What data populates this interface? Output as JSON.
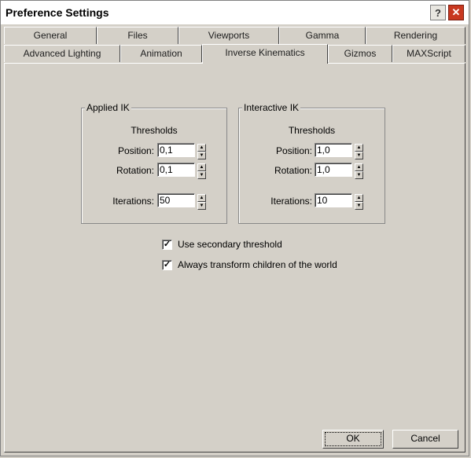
{
  "window": {
    "title": "Preference Settings",
    "help_label": "?",
    "close_label": "✕"
  },
  "tabs": {
    "row1": [
      "General",
      "Files",
      "Viewports",
      "Gamma",
      "Rendering"
    ],
    "row2": [
      "Advanced Lighting",
      "Animation",
      "Inverse Kinematics",
      "Gizmos",
      "MAXScript"
    ],
    "active": "Inverse Kinematics"
  },
  "applied_ik": {
    "title": "Applied IK",
    "thresholds_label": "Thresholds",
    "position_label": "Position:",
    "position_value": "0,1",
    "rotation_label": "Rotation:",
    "rotation_value": "0,1",
    "iterations_label": "Iterations:",
    "iterations_value": "50"
  },
  "interactive_ik": {
    "title": "Interactive IK",
    "thresholds_label": "Thresholds",
    "position_label": "Position:",
    "position_value": "1,0",
    "rotation_label": "Rotation:",
    "rotation_value": "1,0",
    "iterations_label": "Iterations:",
    "iterations_value": "10"
  },
  "options": {
    "secondary_threshold_label": "Use secondary threshold",
    "secondary_threshold_checked": true,
    "always_transform_label": "Always transform children of the world",
    "always_transform_checked": true,
    "check_glyph": "✓"
  },
  "buttons": {
    "ok_label": "OK",
    "cancel_label": "Cancel"
  },
  "spinner": {
    "up": "▲",
    "down": "▼"
  }
}
